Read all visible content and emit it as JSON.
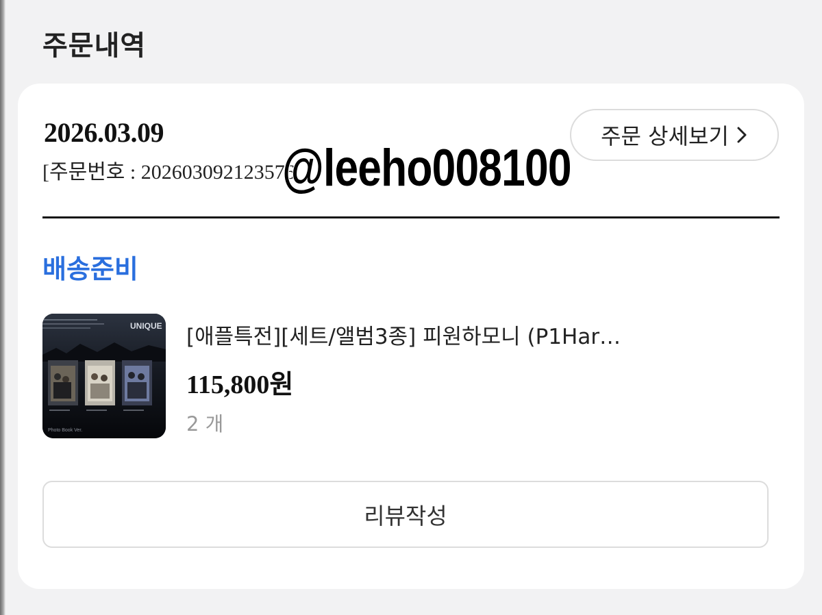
{
  "page": {
    "section_title": "주문내역"
  },
  "order": {
    "date": "2026.03.09",
    "number_label": "[주문번호 : 202603092123576",
    "detail_button_label": "주문 상세보기",
    "status": "배송준비",
    "status_color": "#2a6fde",
    "watermark": "@leeho008100",
    "item": {
      "name": "[애플특전][세트/앨범3종] 피원하모니 (P1Har…",
      "price": "115,800원",
      "quantity": "2 개",
      "thumbnail_text": {
        "brand": "UNIQUE",
        "footer": "Photo Book Ver."
      }
    },
    "review_button_label": "리뷰작성"
  },
  "icons": {
    "detail_chevron": "chevron-right-icon"
  }
}
